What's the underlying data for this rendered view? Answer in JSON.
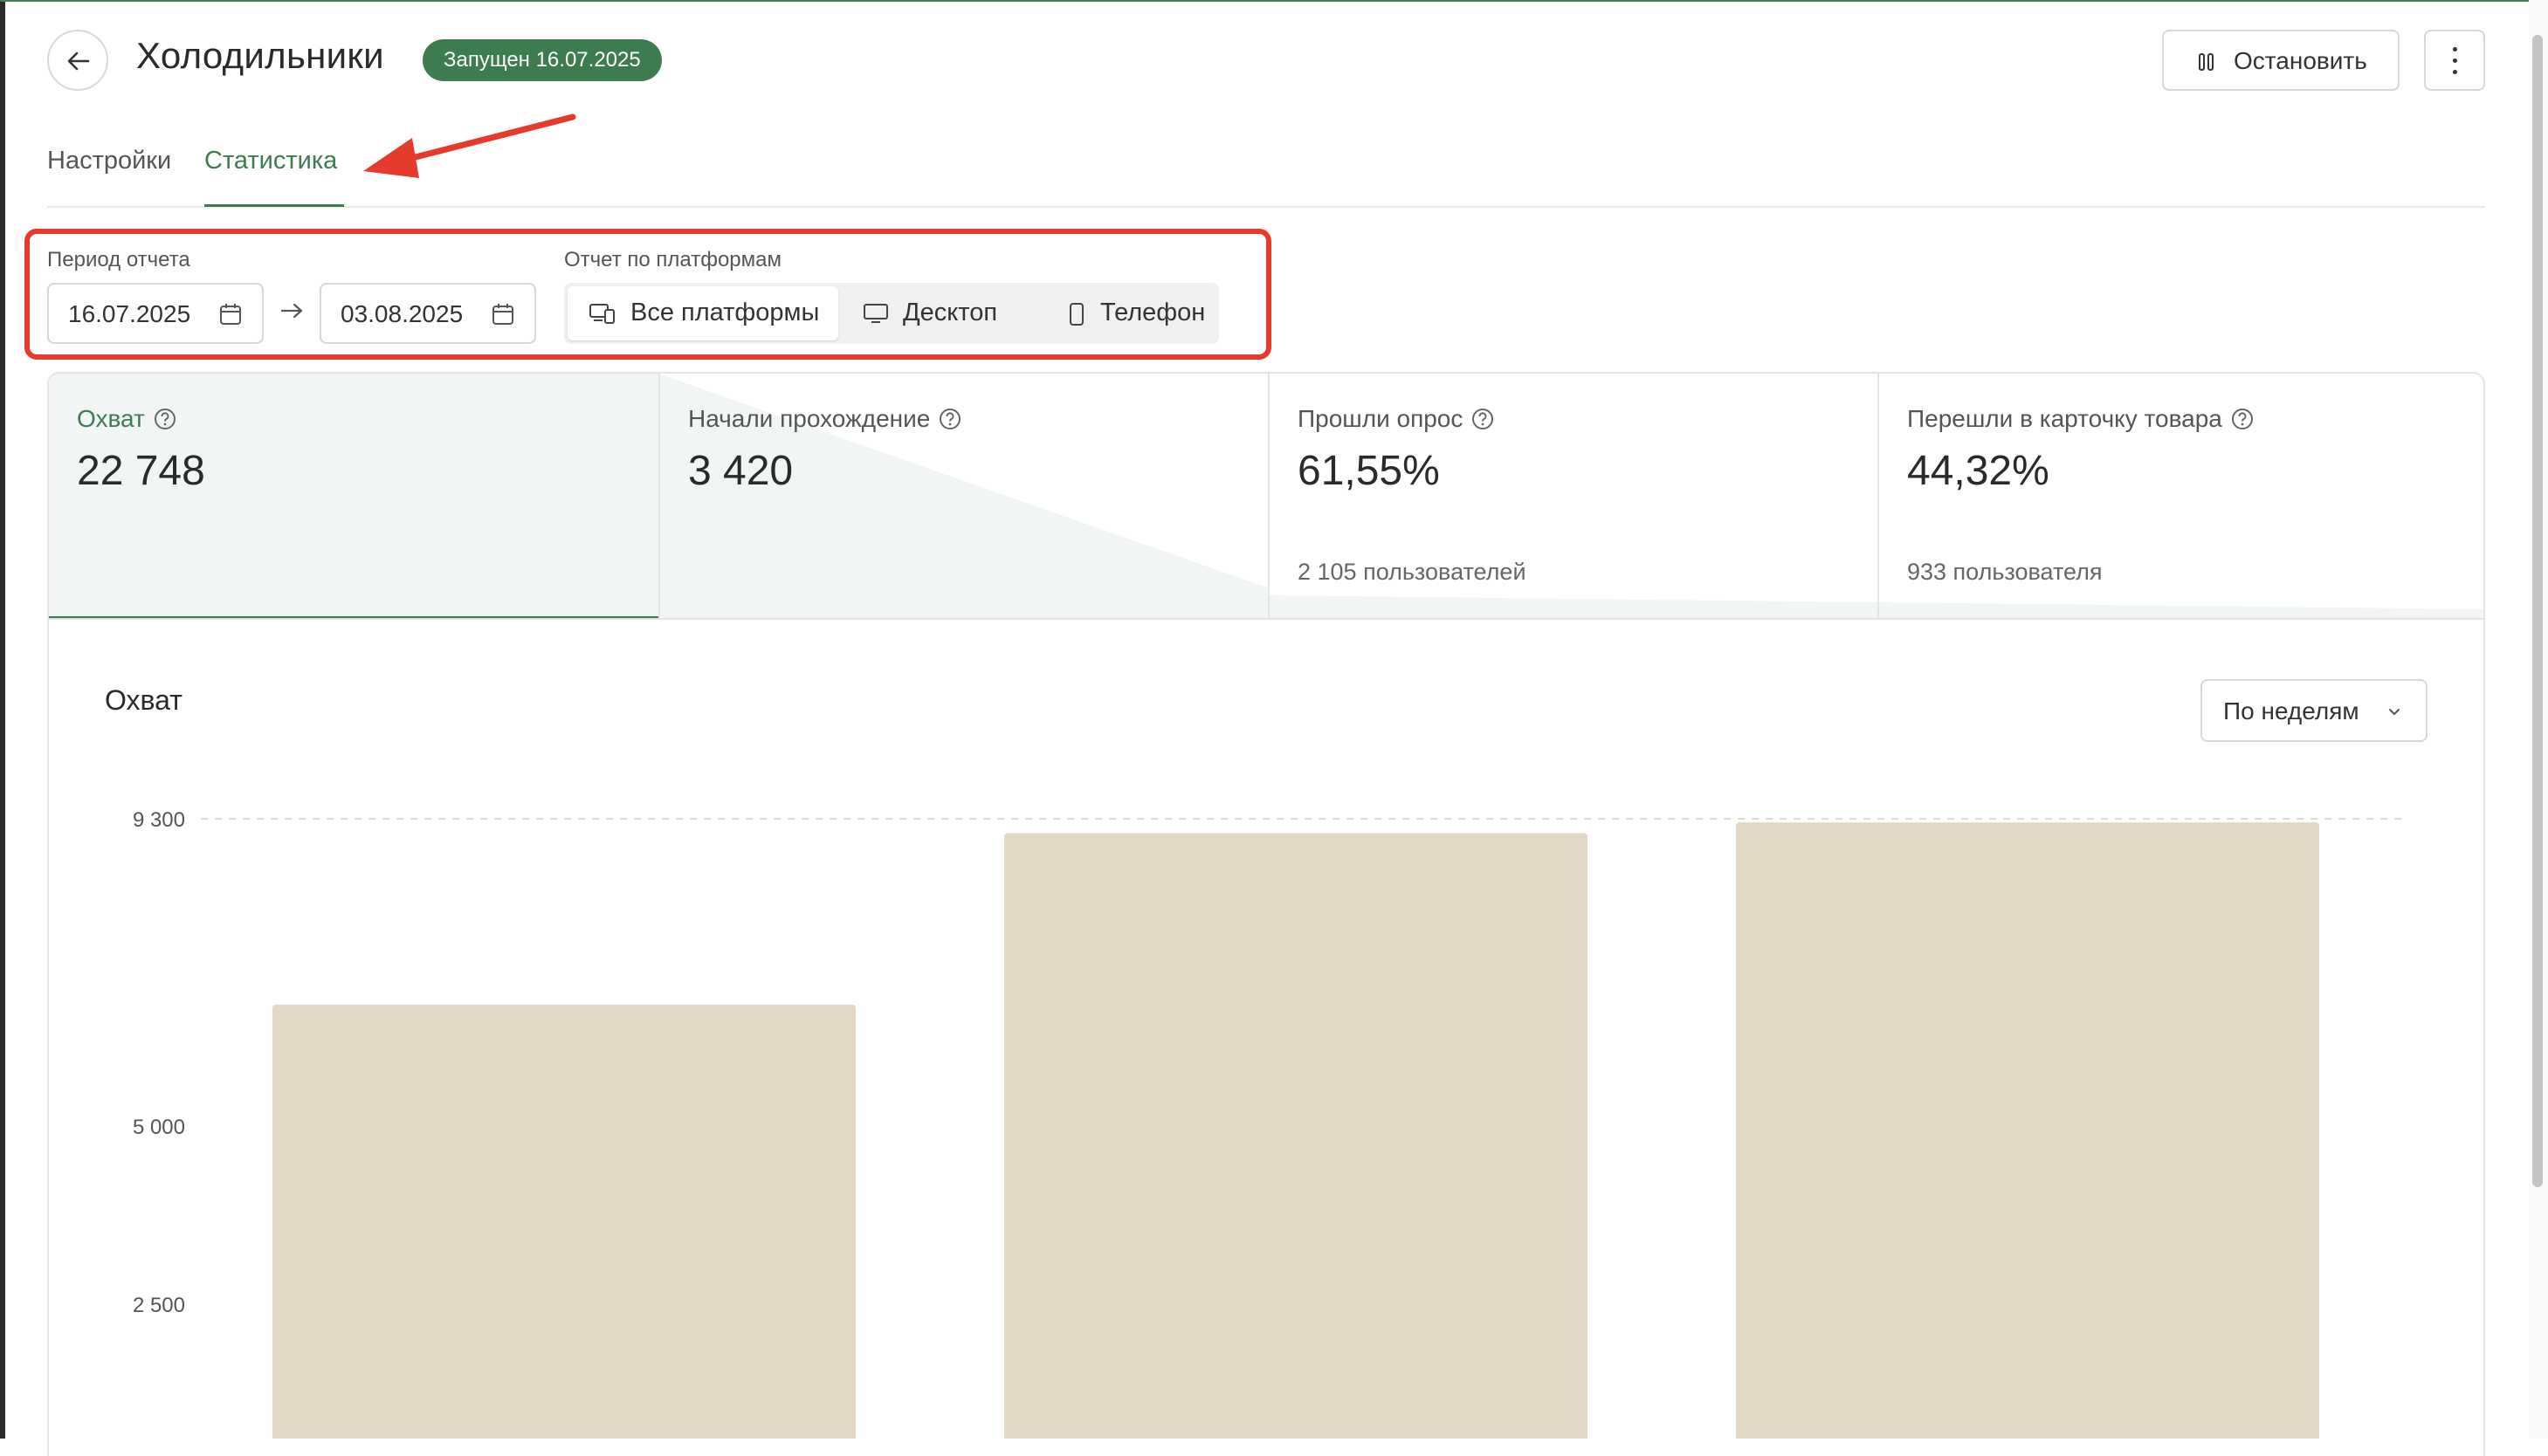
{
  "header": {
    "title": "Холодильники",
    "status_badge": "Запущен 16.07.2025",
    "stop_label": "Остановить"
  },
  "tabs": [
    {
      "label": "Настройки",
      "active": false
    },
    {
      "label": "Статистика",
      "active": true
    }
  ],
  "filters": {
    "period_label": "Период отчета",
    "date_from": "16.07.2025",
    "date_to": "03.08.2025",
    "platform_label": "Отчет по платформам",
    "platforms": [
      {
        "label": "Все платформы",
        "icon": "devices-icon",
        "active": true
      },
      {
        "label": "Десктоп",
        "icon": "desktop-icon",
        "active": false
      },
      {
        "label": "Телефон",
        "icon": "phone-icon",
        "active": false
      }
    ]
  },
  "metrics": [
    {
      "label": "Охват",
      "value": "22 748",
      "sub": "",
      "active": true
    },
    {
      "label": "Начали прохождение",
      "value": "3 420",
      "sub": "",
      "active": false
    },
    {
      "label": "Прошли опрос",
      "value": "61,55%",
      "sub": "2 105 пользователей",
      "active": false
    },
    {
      "label": "Перешли в карточку товара",
      "value": "44,32%",
      "sub": "933 пользователя",
      "active": false
    }
  ],
  "chart_panel": {
    "title": "Охват",
    "period_select": "По неделям"
  },
  "colors": {
    "accent": "#3d7c4f",
    "bar": "#e3d8c6",
    "annotation": "#e53a2c"
  },
  "chart_data": {
    "type": "bar",
    "categories": [
      "",
      "",
      ""
    ],
    "values": [
      6700,
      9100,
      9250
    ],
    "y_ticks": [
      "9 300",
      "5 000",
      "2 500"
    ],
    "y_tick_values": [
      9300,
      5000,
      2500
    ],
    "title": "Охват",
    "xlabel": "",
    "ylabel": "",
    "ylim": [
      0,
      9300
    ],
    "grid": "dashed line at top tick"
  }
}
